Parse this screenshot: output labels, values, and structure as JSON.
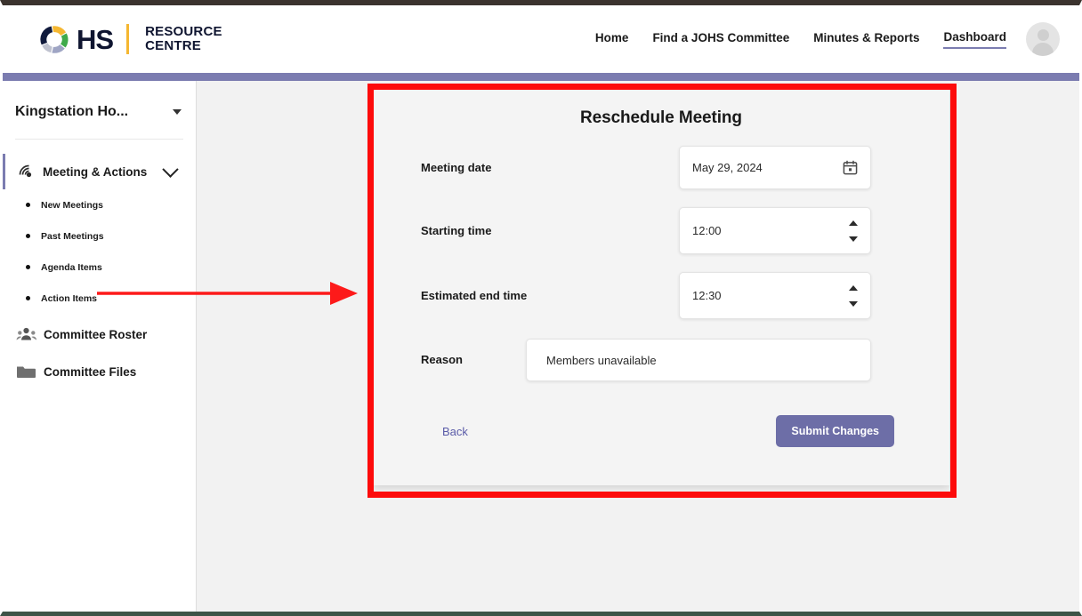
{
  "header": {
    "logo": {
      "ring_icon": "ohs-ring-icon",
      "mark": "HS",
      "line1": "RESOURCE",
      "line2": "CENTRE",
      "ring_colors": [
        "#f5b731",
        "#3faa4b",
        "#9fa5c4",
        "#bfc2cf",
        "#101a3c"
      ],
      "accent": "#f5b731"
    },
    "nav": [
      {
        "label": "Home",
        "active": false
      },
      {
        "label": "Find a JOHS Committee",
        "active": false
      },
      {
        "label": "Minutes & Reports",
        "active": false
      },
      {
        "label": "Dashboard",
        "active": true
      }
    ],
    "avatar_icon": "user-avatar-icon",
    "band_color": "#7b7cb0"
  },
  "sidebar": {
    "org": {
      "label": "Kingstation Ho...",
      "caret_icon": "caret-down-icon"
    },
    "group": {
      "icon": "meeting-actions-icon",
      "label": "Meeting & Actions",
      "chevron_icon": "chevron-down-icon",
      "expanded": true,
      "accent": "#7b7cb0",
      "items": [
        {
          "label": "New Meetings"
        },
        {
          "label": "Past Meetings"
        },
        {
          "label": "Agenda Items"
        },
        {
          "label": "Action Items"
        }
      ]
    },
    "items": [
      {
        "label": "Committee Roster",
        "icon": "people-group-icon"
      },
      {
        "label": "Committee Files",
        "icon": "folder-icon"
      }
    ]
  },
  "form": {
    "title": "Reschedule Meeting",
    "fields": {
      "meeting_date": {
        "label": "Meeting date",
        "value": "May 29, 2024",
        "icon": "calendar-icon"
      },
      "starting_time": {
        "label": "Starting time",
        "value": "12:00",
        "spinner_up_icon": "triangle-up-icon",
        "spinner_down_icon": "triangle-down-icon"
      },
      "end_time": {
        "label": "Estimated end time",
        "value": "12:30",
        "spinner_up_icon": "triangle-up-icon",
        "spinner_down_icon": "triangle-down-icon"
      },
      "reason": {
        "label": "Reason",
        "value": "Members unavailable",
        "placeholder": "Reason"
      }
    },
    "back_label": "Back",
    "submit_label": "Submit Changes",
    "submit_color": "#6d6ea7",
    "link_color": "#5a5ba8"
  },
  "annotations": {
    "highlight_color": "#fd0b0b",
    "arrow_icon": "arrow-right-icon",
    "arrow_color": "#fd1a1a"
  }
}
